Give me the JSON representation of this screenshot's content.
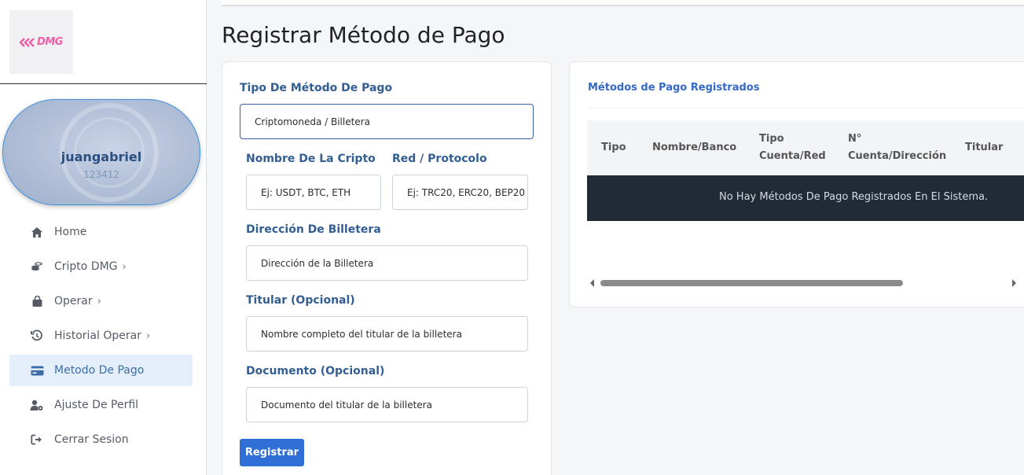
{
  "brand": {
    "logo_text": "DMG",
    "accent_color": "#ec5fa5"
  },
  "profile": {
    "username": "juangabriel",
    "user_id": "123412"
  },
  "sidebar": {
    "items": [
      {
        "label": "Home",
        "icon": "home-icon",
        "has_submenu": false,
        "active": false
      },
      {
        "label": "Cripto DMG",
        "icon": "coins-icon",
        "has_submenu": true,
        "active": false
      },
      {
        "label": "Operar",
        "icon": "bag-icon",
        "has_submenu": true,
        "active": false
      },
      {
        "label": "Historial Operar",
        "icon": "history-icon",
        "has_submenu": true,
        "active": false
      },
      {
        "label": "Metodo De Pago",
        "icon": "credit-card-icon",
        "has_submenu": false,
        "active": true
      },
      {
        "label": "Ajuste De Perfil",
        "icon": "user-gear-icon",
        "has_submenu": false,
        "active": false
      },
      {
        "label": "Cerrar Sesion",
        "icon": "sign-out-icon",
        "has_submenu": false,
        "active": false
      }
    ],
    "chevron": "›"
  },
  "page": {
    "title": "Registrar Método de Pago"
  },
  "form": {
    "tipo_label": "Tipo De Método De Pago",
    "tipo_value": "Criptomoneda / Billetera",
    "cripto_label": "Nombre De La Cripto",
    "cripto_placeholder": "Ej: USDT, BTC, ETH",
    "red_label": "Red / Protocolo",
    "red_placeholder": "Ej: TRC20, ERC20, BEP20",
    "direccion_label": "Dirección De Billetera",
    "direccion_placeholder": "Dirección de la Billetera",
    "titular_label": "Titular (Opcional)",
    "titular_placeholder": "Nombre completo del titular de la billetera",
    "documento_label": "Documento (Opcional)",
    "documento_placeholder": "Documento del titular de la billetera",
    "submit_label": "Registrar"
  },
  "table": {
    "title": "Métodos de Pago Registrados",
    "columns": [
      {
        "line1": "Tipo",
        "line2": ""
      },
      {
        "line1": "Nombre/Banco",
        "line2": ""
      },
      {
        "line1": "Tipo",
        "line2": "Cuenta/Red"
      },
      {
        "line1": "N°",
        "line2": "Cuenta/Dirección"
      },
      {
        "line1": "Titular",
        "line2": ""
      }
    ],
    "empty_message": "No Hay Métodos De Pago Registrados En El Sistema."
  }
}
